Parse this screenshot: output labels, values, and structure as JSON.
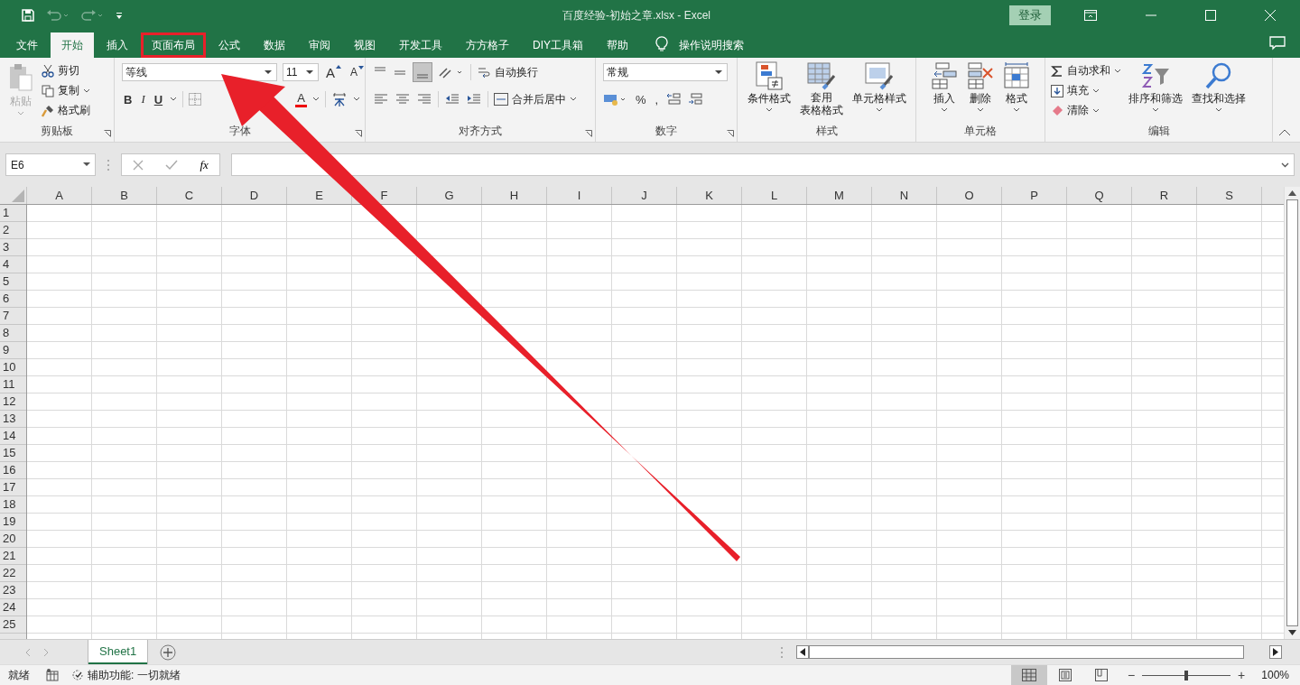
{
  "window": {
    "title": "百度经验-初始之章.xlsx  -  Excel",
    "sign_in": "登录"
  },
  "tabs": [
    {
      "label": "文件",
      "selected": false,
      "annotated": false
    },
    {
      "label": "开始",
      "selected": true,
      "annotated": false
    },
    {
      "label": "插入",
      "selected": false,
      "annotated": false
    },
    {
      "label": "页面布局",
      "selected": false,
      "annotated": true
    },
    {
      "label": "公式",
      "selected": false,
      "annotated": false
    },
    {
      "label": "数据",
      "selected": false,
      "annotated": false
    },
    {
      "label": "审阅",
      "selected": false,
      "annotated": false
    },
    {
      "label": "视图",
      "selected": false,
      "annotated": false
    },
    {
      "label": "开发工具",
      "selected": false,
      "annotated": false
    },
    {
      "label": "方方格子",
      "selected": false,
      "annotated": false
    },
    {
      "label": "DIY工具箱",
      "selected": false,
      "annotated": false
    },
    {
      "label": "帮助",
      "selected": false,
      "annotated": false
    }
  ],
  "tell_me": "操作说明搜索",
  "ribbon": {
    "clipboard": {
      "paste": "粘贴",
      "cut": "剪切",
      "copy": "复制",
      "format_painter": "格式刷",
      "label": "剪贴板"
    },
    "font": {
      "font_name": "等线",
      "font_size": "11",
      "grow": "A",
      "shrink": "A",
      "styles": [
        "B",
        "I",
        "U"
      ],
      "font_color_button": "A",
      "label": "字体"
    },
    "alignment": {
      "wrap_text": "自动换行",
      "merge_center": "合并后居中",
      "label": "对齐方式"
    },
    "number": {
      "format": "常规",
      "percent": "%",
      "comma": ",",
      "label": "数字"
    },
    "styles": {
      "conditional": "条件格式",
      "table_format": [
        "套用",
        "表格格式"
      ],
      "cell_styles": "单元格样式",
      "label": "样式"
    },
    "cells": {
      "insert": "插入",
      "delete": "删除",
      "format": "格式",
      "label": "单元格"
    },
    "editing": {
      "autosum": "自动求和",
      "fill": "填充",
      "clear": "清除",
      "sort_filter": "排序和筛选",
      "find_select": "查找和选择",
      "label": "编辑"
    }
  },
  "formula_bar": {
    "name_box": "E6",
    "fx": "fx"
  },
  "columns": [
    "A",
    "B",
    "C",
    "D",
    "E",
    "F",
    "G",
    "H",
    "I",
    "J",
    "K",
    "L",
    "M",
    "N",
    "O",
    "P",
    "Q",
    "R",
    "S"
  ],
  "rows": [
    "1",
    "2",
    "3",
    "4",
    "5",
    "6",
    "7",
    "8",
    "9",
    "10",
    "11",
    "12",
    "13",
    "14",
    "15",
    "16",
    "17",
    "18",
    "19",
    "20",
    "21",
    "22",
    "23",
    "24",
    "25"
  ],
  "sheet_tabs": [
    {
      "label": "Sheet1",
      "selected": true
    }
  ],
  "status_bar": {
    "ready": "就绪",
    "accessibility": "辅助功能: 一切就绪",
    "views": [
      {
        "kind": "normal",
        "selected": true
      },
      {
        "kind": "page_layout",
        "selected": false
      },
      {
        "kind": "page_break",
        "selected": false
      }
    ],
    "zoom_out": "−",
    "zoom_in": "+",
    "zoom_slider": {
      "level": 0.5
    },
    "zoom": "100%"
  }
}
